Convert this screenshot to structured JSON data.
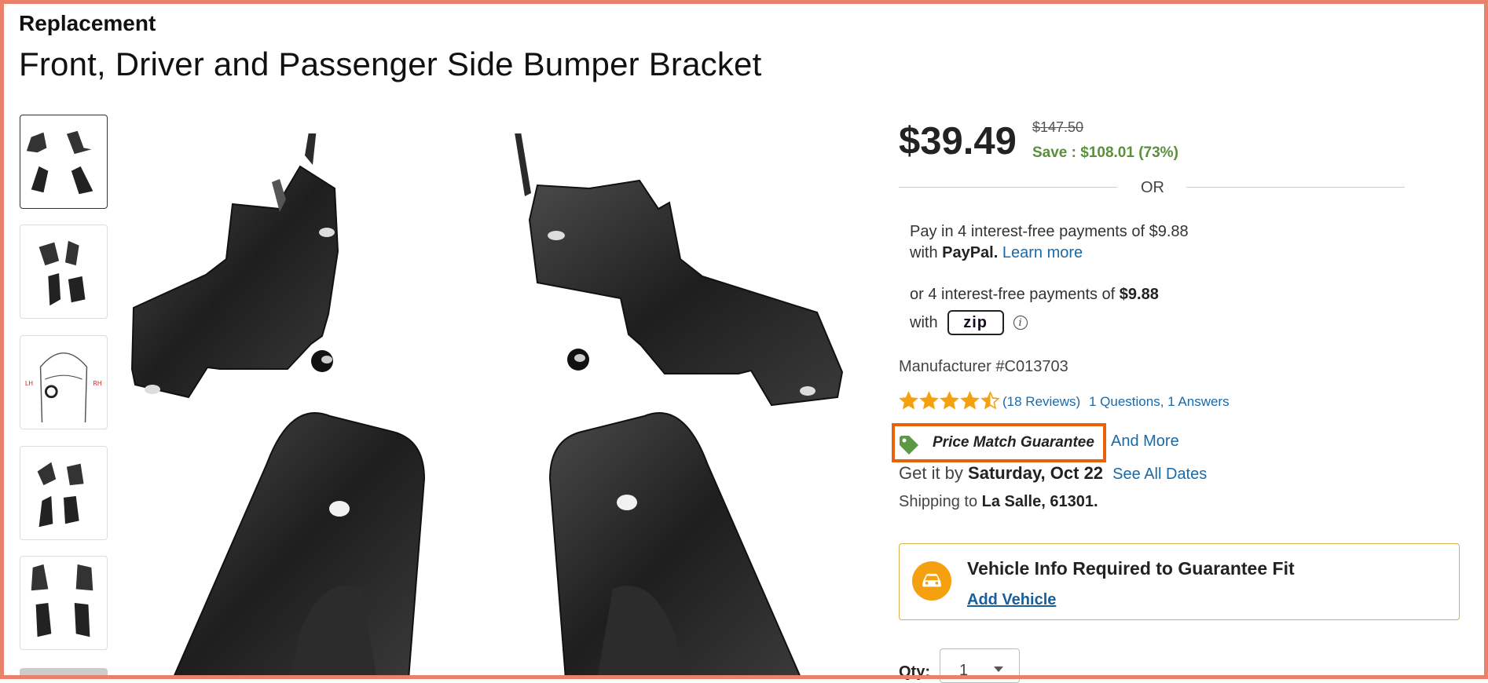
{
  "product": {
    "brand": "Replacement",
    "title": "Front, Driver and Passenger Side Bumper Bracket"
  },
  "gallery": {
    "thumbnails": [
      {
        "name": "thumbnail-four-brackets",
        "active": true
      },
      {
        "name": "thumbnail-bracket-set-alt"
      },
      {
        "name": "thumbnail-vehicle-diagram",
        "labels": [
          "LH",
          "RH"
        ]
      },
      {
        "name": "thumbnail-bracket-set-side"
      },
      {
        "name": "thumbnail-bracket-set-front"
      }
    ]
  },
  "pricing": {
    "price": "$39.49",
    "original_price": "$147.50",
    "savings": "Save : $108.01 (73%)",
    "or_divider": "OR"
  },
  "paypal": {
    "line1": "Pay in 4 interest-free payments of $9.88",
    "with": "with ",
    "brand": "PayPal.",
    "learn_more": "Learn more"
  },
  "zip": {
    "prefix": "or 4 interest-free payments of ",
    "amount": "$9.88",
    "with": "with",
    "badge": "zip",
    "info_icon": "i"
  },
  "manufacturer": "Manufacturer #C013703",
  "rating": {
    "value": 4.5,
    "out_of": 5,
    "reviews": "(18 Reviews)",
    "qa": "1 Questions, 1 Answers"
  },
  "guarantee": {
    "label": "Price Match Guarantee",
    "and_more": "And More",
    "icon": "tag-icon",
    "icon_color": "#5a9a45",
    "highlight_color": "#e8620e"
  },
  "delivery": {
    "prefix": "Get it by ",
    "date": "Saturday, Oct 22",
    "see_all": "See All Dates",
    "ship_prefix": "Shipping to ",
    "ship_location": "La Salle, 61301."
  },
  "vehicle": {
    "title": "Vehicle Info Required to Guarantee Fit",
    "add_link": "Add Vehicle",
    "icon": "car-icon",
    "icon_color": "#f5a00f"
  },
  "quantity": {
    "label": "Qty:",
    "value": "1"
  },
  "colors": {
    "link": "#1a6aa8",
    "save_green": "#5a8f3c",
    "star": "#f5a00f"
  }
}
